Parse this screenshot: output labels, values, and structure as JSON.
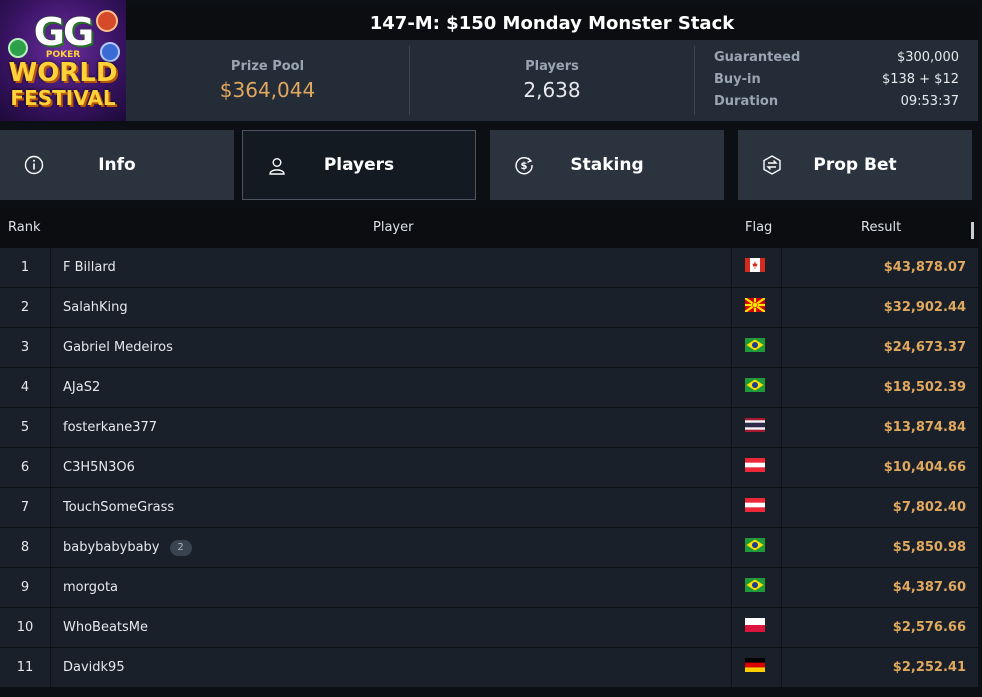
{
  "logo": {
    "line1": "GG",
    "line2": "POKER",
    "line3": "WORLD",
    "line4": "FESTIVAL"
  },
  "tournament": {
    "title": "147-M: $150 Monday Monster Stack"
  },
  "stats": {
    "prize_pool_label": "Prize Pool",
    "prize_pool": "$364,044",
    "players_label": "Players",
    "players": "2,638",
    "guaranteed_label": "Guaranteed",
    "guaranteed": "$300,000",
    "buyin_label": "Buy-in",
    "buyin": "$138 + $12",
    "duration_label": "Duration",
    "duration": "09:53:37"
  },
  "tabs": [
    {
      "label": "Info",
      "icon": "info-icon"
    },
    {
      "label": "Players",
      "icon": "user-icon"
    },
    {
      "label": "Staking",
      "icon": "dollar-cycle-icon"
    },
    {
      "label": "Prop Bet",
      "icon": "prop-bet-icon"
    }
  ],
  "active_tab": "Players",
  "table": {
    "headers": {
      "rank": "Rank",
      "player": "Player",
      "flag": "Flag",
      "result": "Result"
    },
    "rows": [
      {
        "rank": "1",
        "player": "F Billard",
        "flag": "canada",
        "result": "$43,878.07"
      },
      {
        "rank": "2",
        "player": "SalahKing",
        "flag": "north-macedonia",
        "result": "$32,902.44"
      },
      {
        "rank": "3",
        "player": "Gabriel Medeiros",
        "flag": "brazil",
        "result": "$24,673.37"
      },
      {
        "rank": "4",
        "player": "AJaS2",
        "flag": "brazil",
        "result": "$18,502.39"
      },
      {
        "rank": "5",
        "player": "fosterkane377",
        "flag": "thailand",
        "result": "$13,874.84"
      },
      {
        "rank": "6",
        "player": "C3H5N3O6",
        "flag": "austria",
        "result": "$10,404.66"
      },
      {
        "rank": "7",
        "player": "TouchSomeGrass",
        "flag": "austria",
        "result": "$7,802.40"
      },
      {
        "rank": "8",
        "player": "babybabybaby",
        "badge": "2",
        "flag": "brazil",
        "result": "$5,850.98"
      },
      {
        "rank": "9",
        "player": "morgota",
        "flag": "brazil",
        "result": "$4,387.60"
      },
      {
        "rank": "10",
        "player": "WhoBeatsMe",
        "flag": "poland",
        "result": "$2,576.66"
      },
      {
        "rank": "11",
        "player": "Davidk95",
        "flag": "germany",
        "result": "$2,252.41"
      }
    ]
  },
  "colors": {
    "accent_gold": "#e1a95f",
    "panel": "#242c37",
    "row": "#1a2029"
  }
}
